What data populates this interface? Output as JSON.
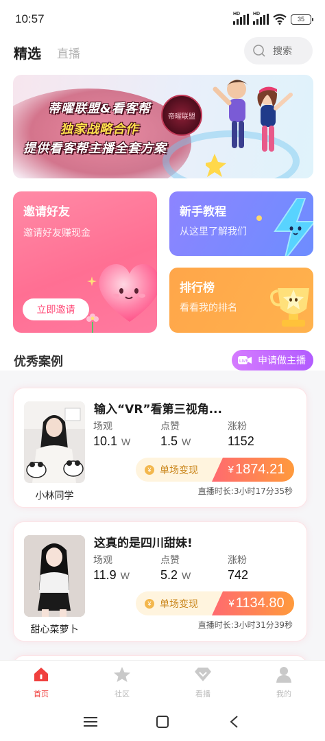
{
  "status_bar": {
    "time": "10:57",
    "signal_label_1": "HD",
    "signal_label_2": "HD",
    "battery": "35"
  },
  "header": {
    "tab_featured": "精选",
    "tab_live": "直播",
    "search_placeholder": "搜索"
  },
  "banner": {
    "line1": "蒂曜联盟&看客帮",
    "line2": "独家战略合作",
    "line3": "提供看客帮主播全套方案",
    "logo_text": "帝曜联盟"
  },
  "feature_cards": {
    "invite": {
      "title": "邀请好友",
      "subtitle": "邀请好友赚现金",
      "button": "立即邀请"
    },
    "tutorial": {
      "title": "新手教程",
      "subtitle": "从这里了解我们"
    },
    "ranking": {
      "title": "排行榜",
      "subtitle": "看看我的排名"
    }
  },
  "cases_section": {
    "title": "优秀案例",
    "apply_button": "申请做主播"
  },
  "cases": [
    {
      "name": "小林同学",
      "title": "输入“VR”看第三视角...",
      "labels": {
        "views": "场观",
        "likes": "点赞",
        "fans": "涨粉"
      },
      "views": "10.1",
      "views_unit": "W",
      "likes": "1.5",
      "likes_unit": "W",
      "fans": "1152",
      "revenue_label": "单场变现",
      "yen_symbol": "¥",
      "revenue": "1874.21",
      "duration": "直播时长:3小时17分35秒"
    },
    {
      "name": "甜心菜萝卜",
      "title": "这真的是四川甜妹!",
      "labels": {
        "views": "场观",
        "likes": "点赞",
        "fans": "涨粉"
      },
      "views": "11.9",
      "views_unit": "W",
      "likes": "5.2",
      "likes_unit": "W",
      "fans": "742",
      "revenue_label": "单场变现",
      "yen_symbol": "¥",
      "revenue": "1134.80",
      "duration": "直播时长:3小时31分39秒"
    }
  ],
  "bottom_nav": [
    {
      "label": "首页",
      "icon": "home-icon",
      "active": true
    },
    {
      "label": "社区",
      "icon": "star-icon",
      "active": false
    },
    {
      "label": "看播",
      "icon": "diamond-icon",
      "active": false
    },
    {
      "label": "我的",
      "icon": "person-icon",
      "active": false
    }
  ],
  "colors": {
    "accent": "#f0403e",
    "invite_card": "#ff7aa0",
    "tutorial_card": "#7b8aff",
    "ranking_card": "#ffad4a",
    "apply_button": "#c46cff"
  }
}
